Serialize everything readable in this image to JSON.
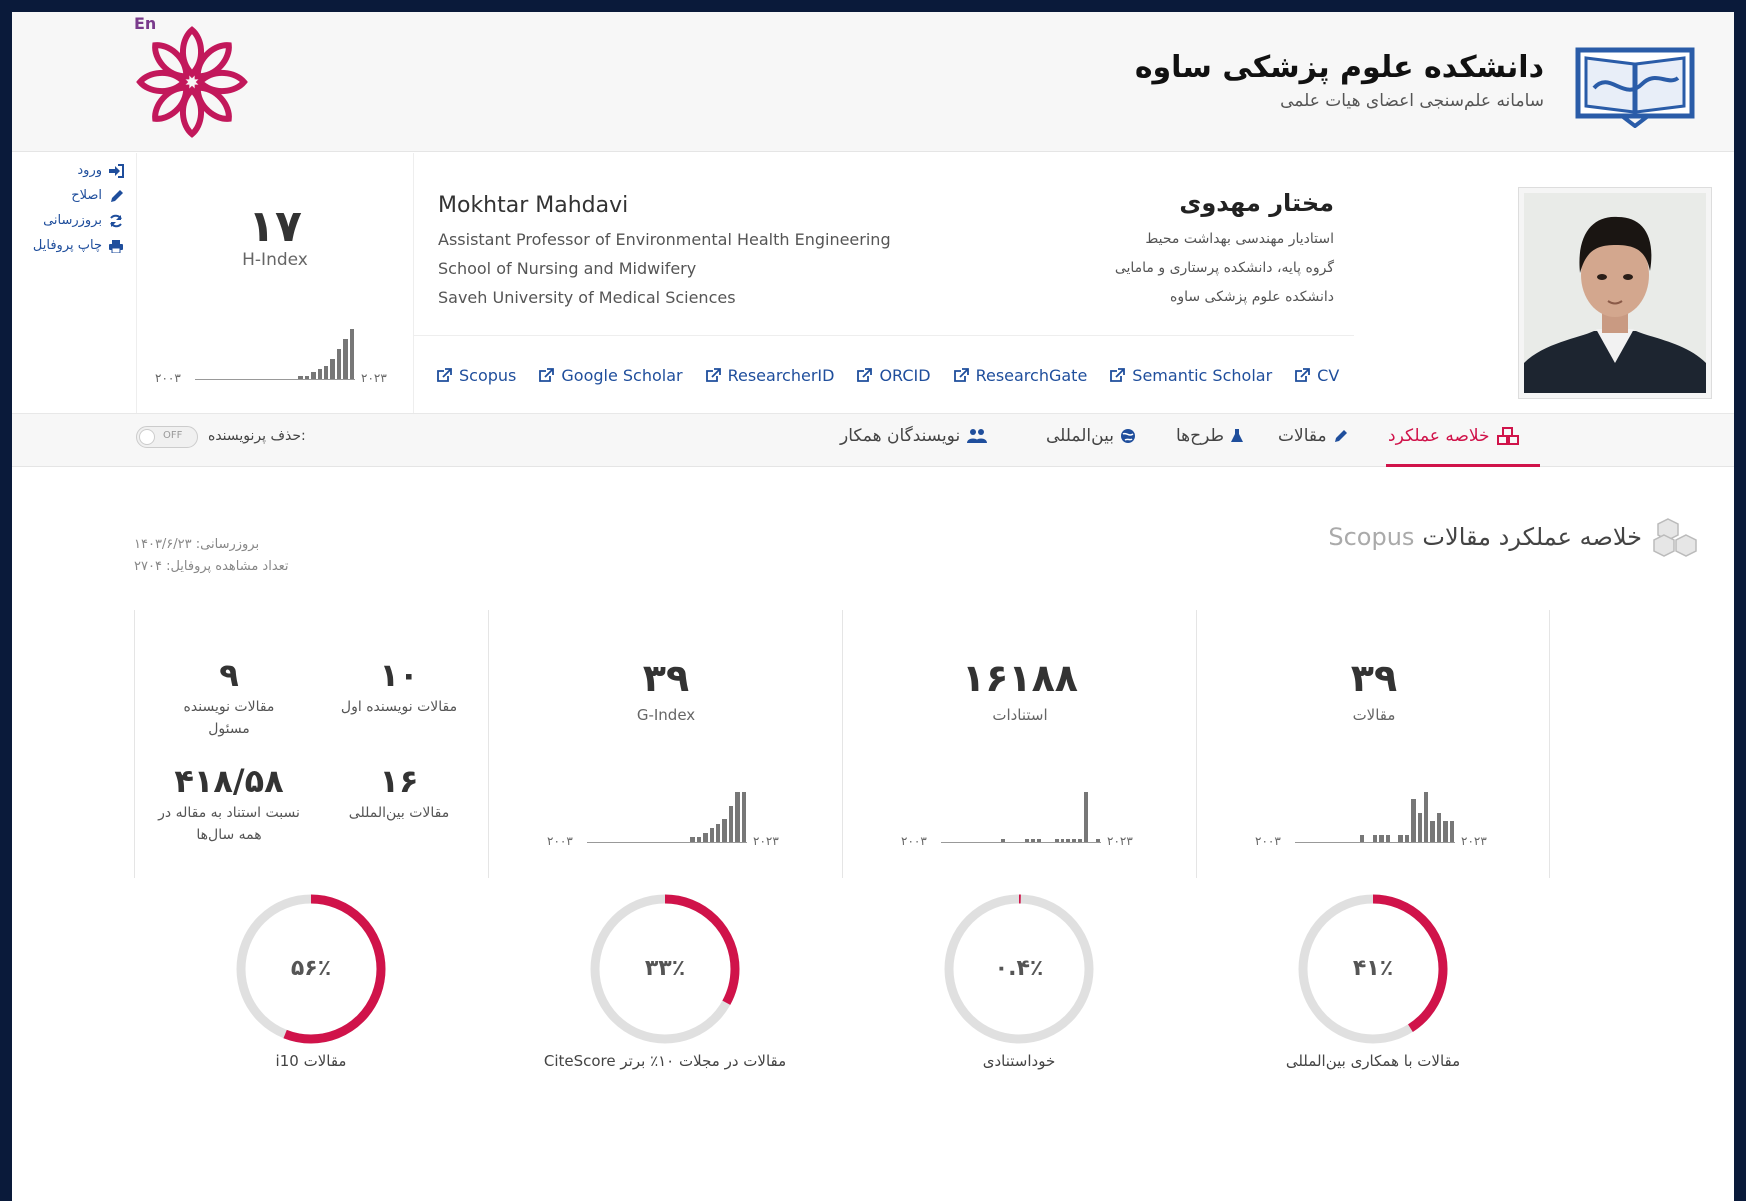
{
  "header": {
    "lang_link": "En",
    "univ_name": "دانشکده علوم پزشکی ساوه",
    "univ_sub": "سامانه علم‌سنجی اعضای هیات علمی"
  },
  "sidebar": {
    "items": [
      {
        "label": "ورود",
        "icon": "sign-in-icon"
      },
      {
        "label": "اصلاح",
        "icon": "pencil-icon"
      },
      {
        "label": "بروزرسانی",
        "icon": "refresh-icon"
      },
      {
        "label": "چاپ پروفایل",
        "icon": "print-icon"
      }
    ]
  },
  "hindex": {
    "value": "۱۷",
    "label": "H-Index",
    "x_start": "۲۰۰۳",
    "x_end": "۲۰۲۳",
    "bars": [
      0,
      0,
      0,
      0,
      0,
      0,
      0,
      0,
      0,
      0,
      0,
      0,
      0,
      0,
      0,
      0,
      1,
      1,
      2,
      3,
      4,
      6,
      9,
      12,
      15
    ]
  },
  "person": {
    "name_en": "Mokhtar Mahdavi",
    "title_en": "Assistant Professor of Environmental Health Engineering",
    "school_en": "School of Nursing and Midwifery",
    "univ_en": "Saveh University of Medical Sciences",
    "name_fa": "مختار مهدوی",
    "title_fa": "استادیار مهندسی بهداشت محیط",
    "school_fa": "گروه پایه، دانشکده پرستاری و مامایی",
    "univ_fa": "دانشکده علوم پزشکی ساوه"
  },
  "links": [
    "Scopus",
    "Google Scholar",
    "ResearcherID",
    "ORCID",
    "ResearchGate",
    "Semantic Scholar",
    "CV"
  ],
  "tabs": {
    "summary": "خلاصه عملکرد",
    "articles": "مقالات",
    "projects": "طرح‌ها",
    "international": "بین‌المللی",
    "coauthors": "نویسندگان همکار",
    "toggle_state": "OFF",
    "toggle_label": "حذف پرنویسنده:"
  },
  "section": {
    "title": "خلاصه عملکرد مقالات",
    "source": "Scopus",
    "updated": "بروزرسانی: ۱۴۰۳/۶/۲۳",
    "views": "تعداد مشاهده پروفایل: ۲۷۰۴"
  },
  "stats": {
    "articles": {
      "value": "۳۹",
      "label": "مقالات",
      "x_start": "۲۰۰۳",
      "x_end": "۲۰۲۳",
      "bars": [
        0,
        0,
        0,
        0,
        0,
        0,
        0,
        0,
        0,
        0,
        1,
        0,
        1,
        1,
        1,
        0,
        1,
        1,
        6,
        4,
        7,
        3,
        4,
        3,
        3
      ]
    },
    "citations": {
      "value": "۱۶۱۸۸",
      "label": "استنادات",
      "x_start": "۲۰۰۳",
      "x_end": "۲۰۲۳",
      "bars": [
        0,
        0,
        0,
        0,
        0,
        0,
        0,
        0,
        0,
        0,
        1,
        0,
        0,
        0,
        1,
        1,
        1,
        0,
        0,
        1,
        1,
        1,
        1,
        1,
        24,
        0,
        1
      ]
    },
    "gindex": {
      "value": "۳۹",
      "label": "G-Index",
      "x_start": "۲۰۰۳",
      "x_end": "۲۰۲۳",
      "bars": [
        0,
        0,
        0,
        0,
        0,
        0,
        0,
        0,
        0,
        0,
        0,
        0,
        0,
        0,
        0,
        0,
        1,
        1,
        2,
        3,
        4,
        5,
        8,
        11,
        11
      ]
    },
    "first_author": {
      "value": "۱۰",
      "label": "مقالات نویسنده اول"
    },
    "corresponding": {
      "value": "۹",
      "label": "مقالات نویسنده مسئول"
    },
    "international": {
      "value": "۱۶",
      "label": "مقالات بین‌المللی"
    },
    "cite_ratio": {
      "value": "۴۱۸/۵۸",
      "label": "نسبت استناد به مقاله در همه سال‌ها"
    }
  },
  "donuts": [
    {
      "pct": 41,
      "text": "۴۱٪",
      "label": "مقالات با همکاری بین‌المللی"
    },
    {
      "pct": 0.4,
      "text": "۰.۴٪",
      "label": "خوداستنادی"
    },
    {
      "pct": 33,
      "text": "۳۳٪",
      "label": "مقالات در مجلات ۱۰٪ برتر CiteScore"
    },
    {
      "pct": 56,
      "text": "۵۶٪",
      "label": "مقالات i10"
    }
  ],
  "colors": {
    "accent": "#d0134a",
    "link": "#1f4e9c",
    "track": "#e0e0e0",
    "bar": "#777777"
  }
}
